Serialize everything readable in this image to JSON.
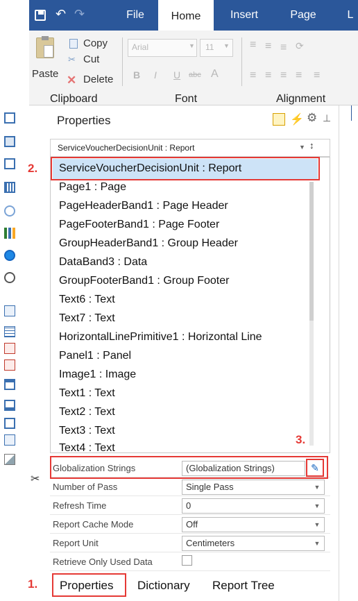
{
  "ribbon": {
    "tabs": [
      "File",
      "Home",
      "Insert",
      "Page",
      "L"
    ],
    "active_tab": "Home",
    "copy": "Copy",
    "cut": "Cut",
    "delete": "Delete",
    "paste": "Paste",
    "font_name": "Arial",
    "font_size": "11",
    "bold": "B",
    "italic": "I",
    "underline": "U",
    "strike": "abc",
    "font_color": "A",
    "groups": [
      "Clipboard",
      "Font",
      "Alignment"
    ]
  },
  "panel": {
    "title": "Properties",
    "selector": "ServiceVoucherDecisionUnit : Report",
    "dropdown_items": [
      "ServiceVoucherDecisionUnit : Report",
      "Page1 : Page",
      "PageHeaderBand1 : Page Header",
      "PageFooterBand1 : Page Footer",
      "GroupHeaderBand1 : Group Header",
      "DataBand3 : Data",
      "GroupFooterBand1 : Group Footer",
      "Text6 : Text",
      "Text7 : Text",
      "HorizontalLinePrimitive1 : Horizontal Line",
      "Panel1 : Panel",
      "Image1 : Image",
      "Text1 : Text",
      "Text2 : Text",
      "Text3 : Text",
      "Text4 : Text"
    ],
    "properties": [
      {
        "label": "Globalization Strings",
        "value": "(Globalization Strings)"
      },
      {
        "label": "Number of Pass",
        "value": "Single Pass"
      },
      {
        "label": "Refresh Time",
        "value": "0"
      },
      {
        "label": "Report Cache Mode",
        "value": "Off"
      },
      {
        "label": "Report Unit",
        "value": "Centimeters"
      },
      {
        "label": "Retrieve Only Used Data",
        "value": ""
      }
    ]
  },
  "bottom_tabs": [
    "Properties",
    "Dictionary",
    "Report Tree"
  ],
  "callouts": [
    "1.",
    "2.",
    "3."
  ],
  "colors": {
    "ribbon_blue": "#2b579a",
    "highlight": "#cde3f7",
    "callout_red": "#e53935"
  }
}
